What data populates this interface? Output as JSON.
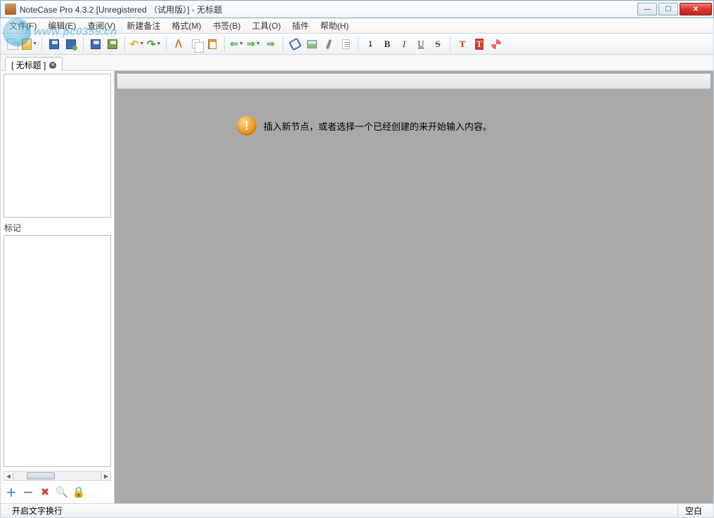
{
  "window": {
    "title": "NoteCase Pro 4.3.2 [Unregistered （试用版）] - 无标题"
  },
  "watermark": "www.pc0359.cn",
  "menu": {
    "file": "文件(F)",
    "edit": "编辑(E)",
    "view": "查阅(V)",
    "newnote": "新建备注",
    "format": "格式(M)",
    "bookmark": "书签(B)",
    "tools": "工具(O)",
    "plugins": "插件",
    "help": "帮助(H)"
  },
  "toolbar": {
    "bold": "B",
    "italic": "I",
    "underline": "U",
    "strike": "S",
    "textcolor": "T",
    "highlight": "T"
  },
  "tab": {
    "label": "[ 无标题 ]"
  },
  "sidebar": {
    "tags_label": "标记"
  },
  "editor": {
    "hint": "插入新节点，或者选择一个已经创建的来开始输入内容。"
  },
  "status": {
    "left": "开启文字换行",
    "right": "空白"
  }
}
